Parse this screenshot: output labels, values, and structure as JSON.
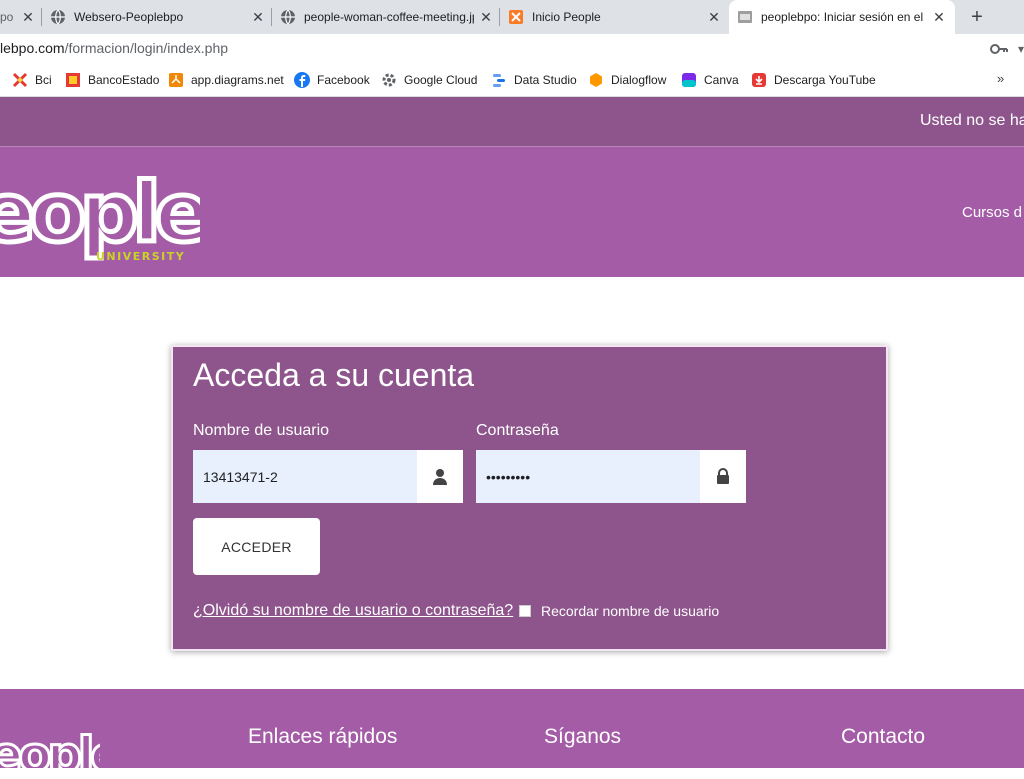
{
  "browser": {
    "tabs": [
      {
        "title": "Websero-Peoplebpo"
      },
      {
        "title": "people-woman-coffee-meeting.jpg"
      },
      {
        "title": "Inicio People"
      },
      {
        "title": "peoplebpo: Iniciar sesión en el sitio"
      }
    ],
    "partial_tab_title": "po",
    "url_domain": "lebpo.com",
    "url_path": "/formacion/login/index.php",
    "bookmarks": [
      "Bci",
      "BancoEstado",
      "app.diagrams.net",
      "Facebook",
      "Google Cloud",
      "Data Studio",
      "Dialogflow",
      "Canva",
      "Descarga YouTube"
    ],
    "bookmarks_overflow": "»"
  },
  "site": {
    "login_status": "Usted no se ha",
    "nav_courses": "Cursos d",
    "logo_text": "eople",
    "logo_subtitle": "UNIVERSITY",
    "colors": {
      "primary": "#a45ca7",
      "dark": "#8e558c",
      "logo_accent": "#c8d423"
    }
  },
  "login": {
    "title": "Acceda a su cuenta",
    "username_label": "Nombre de usuario",
    "username_value": "13413471-2",
    "password_label": "Contraseña",
    "password_value": "•••••••••",
    "submit_label": "ACCEDER",
    "forgot_link": "¿Olvidó su nombre de usuario o contraseña?",
    "remember_label": "Recordar nombre de usuario"
  },
  "footer": {
    "quick_links": "Enlaces rápidos",
    "follow_us": "Síganos",
    "contact": "Contacto"
  }
}
